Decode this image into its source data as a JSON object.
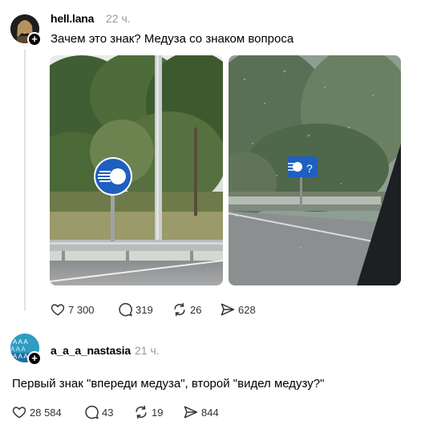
{
  "post1": {
    "username": "hell.lana",
    "time": "22 ч.",
    "text": "Зачем это знак? Медуза со знаком вопроса",
    "avatar_icon": "avatar-photo-icon",
    "stats": {
      "likes": "7 300",
      "replies": "319",
      "reposts": "26",
      "shares": "628"
    }
  },
  "post2": {
    "username": "a_a_a_nastasia",
    "time": "21 ч.",
    "text": "Первый знак \"впереди медуза\", второй \"видел медузу?\"",
    "avatar_icon": "avatar-pattern-icon",
    "stats": {
      "likes": "28 584",
      "replies": "43",
      "reposts": "19",
      "shares": "844"
    }
  },
  "colors": {
    "sign_blue": "#1f5fbf",
    "time_gray": "#999999",
    "thread_line": "#e2e2e2"
  }
}
